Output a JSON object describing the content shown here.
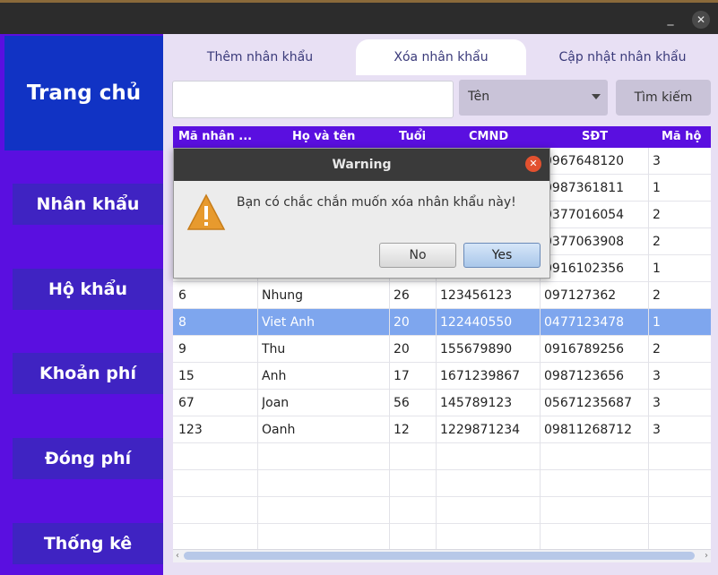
{
  "window": {
    "minimize_glyph": "_",
    "close_glyph": "✕"
  },
  "sidebar": {
    "home_label": "Trang chủ",
    "items": [
      {
        "label": "Nhân khẩu"
      },
      {
        "label": "Hộ khẩu"
      },
      {
        "label": "Khoản phí"
      },
      {
        "label": "Đóng phí"
      },
      {
        "label": "Thống kê"
      }
    ]
  },
  "tabs": [
    {
      "label": "Thêm nhân khẩu",
      "active": false
    },
    {
      "label": "Xóa nhân khẩu",
      "active": true
    },
    {
      "label": "Cập nhật nhân khẩu",
      "active": false
    }
  ],
  "search": {
    "value": "",
    "filter_selected": "Tên",
    "button_label": "Tìm kiếm"
  },
  "table": {
    "columns": [
      "Mã nhân ...",
      "Họ và tên",
      "Tuổi",
      "CMND",
      "SĐT",
      "Mã hộ"
    ],
    "rows": [
      [
        "",
        "",
        "",
        "",
        "0967648120",
        "3"
      ],
      [
        "",
        "",
        "",
        "",
        "0987361811",
        "1"
      ],
      [
        "",
        "",
        "",
        "",
        "0377016054",
        "2"
      ],
      [
        "",
        "",
        "",
        "",
        "0377063908",
        "2"
      ],
      [
        "",
        "",
        "",
        "",
        "0916102356",
        "1"
      ],
      [
        "6",
        "Nhung",
        "26",
        "123456123",
        "097127362",
        "2"
      ],
      [
        "8",
        "Viet Anh",
        "20",
        "122440550",
        "0477123478",
        "1"
      ],
      [
        "9",
        "Thu",
        "20",
        "155679890",
        "0916789256",
        "2"
      ],
      [
        "15",
        "Anh",
        "17",
        "1671239867",
        "0987123656",
        "3"
      ],
      [
        "67",
        "Joan",
        "56",
        "145789123",
        "05671235687",
        "3"
      ],
      [
        "123",
        "Oanh",
        "12",
        "1229871234",
        "09811268712",
        "3"
      ]
    ],
    "selected_row": 6,
    "empty_rows": 4
  },
  "dialog": {
    "title": "Warning",
    "message": "Bạn có chắc chắn muốn xóa nhân khẩu này!",
    "no_label": "No",
    "yes_label": "Yes",
    "icon": "warning-icon"
  },
  "colors": {
    "sidebar": "#5a0fe0",
    "home": "#1133c4",
    "accent_selected": "#7ea6ee"
  }
}
